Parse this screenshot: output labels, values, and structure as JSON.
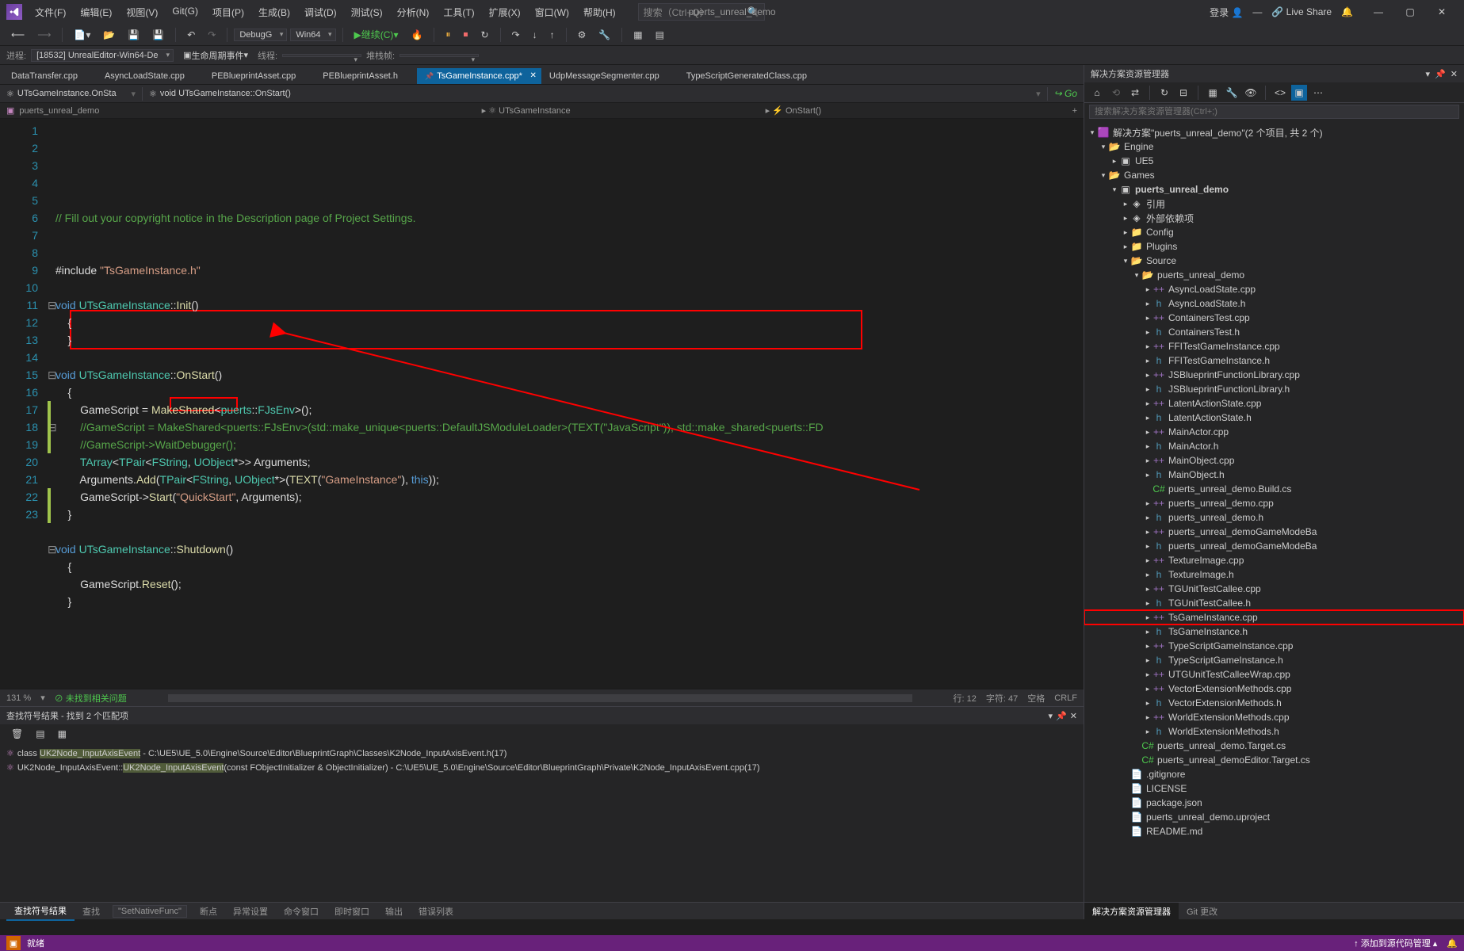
{
  "title_center": "puerts_unreal_demo",
  "login": "登录",
  "live_share": "Live Share",
  "menu": [
    "文件(F)",
    "编辑(E)",
    "视图(V)",
    "Git(G)",
    "项目(P)",
    "生成(B)",
    "调试(D)",
    "测试(S)",
    "分析(N)",
    "工具(T)",
    "扩展(X)",
    "窗口(W)",
    "帮助(H)"
  ],
  "search_placeholder": "搜索（Ctrl+Q）",
  "toolbar": {
    "config": "DebugG",
    "platform": "Win64",
    "run_label": "继续(C)"
  },
  "toolbar2": {
    "process_label": "进程:",
    "process": "[18532] UnrealEditor-Win64-De",
    "lifecycle": "生命周期事件",
    "thread_label": "线程:",
    "stack_label": "堆栈帧:"
  },
  "tabs": [
    {
      "label": "DataTransfer.cpp",
      "pinned": false
    },
    {
      "label": "AsyncLoadState.cpp",
      "pinned": false
    },
    {
      "label": "PEBlueprintAsset.cpp",
      "pinned": false
    },
    {
      "label": "PEBlueprintAsset.h",
      "pinned": false
    },
    {
      "label": "TsGameInstance.cpp*",
      "pinned": true,
      "active": true
    },
    {
      "label": "UdpMessageSegmenter.cpp",
      "pinned": false
    },
    {
      "label": "TypeScriptGeneratedClass.cpp",
      "pinned": false
    }
  ],
  "nav": {
    "scope": "UTsGameInstance.OnSta",
    "func": "void UTsGameInstance::OnStart()",
    "go": "Go"
  },
  "breadcrumb": {
    "project": "puerts_unreal_demo",
    "class": "UTsGameInstance",
    "method": "OnStart()"
  },
  "code": {
    "lines": [
      {
        "n": 1,
        "t": "// Fill out your copyright notice in the Description page of Project Settings.",
        "cls": "c-comment"
      },
      {
        "n": 2,
        "t": ""
      },
      {
        "n": 3,
        "t": ""
      },
      {
        "n": 4,
        "html": "<span class='c-punct'>#include </span><span class='c-string'>\"TsGameInstance.h\"</span>"
      },
      {
        "n": 5,
        "t": ""
      },
      {
        "n": 6,
        "fold": "⊟",
        "html": "<span class='c-keyword'>void</span> <span class='c-type'>UTsGameInstance</span>::<span class='c-func'>Init</span>()"
      },
      {
        "n": 7,
        "t": "{",
        "indent": 1
      },
      {
        "n": 8,
        "t": "}",
        "indent": 1
      },
      {
        "n": 9,
        "t": ""
      },
      {
        "n": 10,
        "fold": "⊟",
        "html": "<span class='c-keyword'>void</span> <span class='c-type'>UTsGameInstance</span>::<span class='c-func'>OnStart</span>()"
      },
      {
        "n": 11,
        "t": "{",
        "indent": 1
      },
      {
        "n": 12,
        "indent": 2,
        "changed": true,
        "html": "GameScript = <span class='c-func'>MakeShared</span>&lt;<span class='c-type'>puerts</span>::<span class='c-type'>FJsEnv</span>&gt;();"
      },
      {
        "n": 13,
        "fold": "⊟",
        "indent": 2,
        "changed": true,
        "html": "<span class='c-comment'>//GameScript = MakeShared&lt;puerts::FJsEnv&gt;(std::make_unique&lt;puerts::DefaultJSModuleLoader&gt;(TEXT(\"JavaScript\")), std::make_shared&lt;puerts::FD</span>"
      },
      {
        "n": 14,
        "indent": 2,
        "changed": true,
        "html": "<span class='c-comment'>//GameScript-&gt;WaitDebugger();</span>"
      },
      {
        "n": 15,
        "indent": 2,
        "html": "<span class='c-type'>TArray</span>&lt;<span class='c-type'>TPair</span>&lt;<span class='c-type'>FString</span>, <span class='c-type'>UObject</span>*&gt;&gt; Arguments;"
      },
      {
        "n": 16,
        "indent": 2,
        "html": "Arguments.<span class='c-func'>Add</span>(<span class='c-type'>TPair</span>&lt;<span class='c-type'>FString</span>, <span class='c-type'>UObject</span>*&gt;(<span class='c-func'>TEXT</span>(<span class='c-string'>\"GameInstance\"</span>), <span class='c-keyword'>this</span>));"
      },
      {
        "n": 17,
        "indent": 2,
        "changed": true,
        "html": "GameScript-&gt;<span class='c-func'>Start</span>(<span class='c-string'>\"QuickStart\"</span>, Arguments);"
      },
      {
        "n": 18,
        "t": "}",
        "indent": 1,
        "changed": true
      },
      {
        "n": 19,
        "t": ""
      },
      {
        "n": 20,
        "fold": "⊟",
        "html": "<span class='c-keyword'>void</span> <span class='c-type'>UTsGameInstance</span>::<span class='c-func'>Shutdown</span>()"
      },
      {
        "n": 21,
        "t": "{",
        "indent": 1
      },
      {
        "n": 22,
        "indent": 2,
        "html": "GameScript.<span class='c-func'>Reset</span>();"
      },
      {
        "n": 23,
        "t": "}",
        "indent": 1
      }
    ]
  },
  "status_strip": {
    "zoom": "131 %",
    "issues": "未找到相关问题",
    "ln_col": "行: 12",
    "char": "字符: 47",
    "ins": "空格",
    "crlf": "CRLF"
  },
  "find": {
    "title": "查找符号结果 - 找到 2 个匹配项",
    "results": [
      {
        "icon": "⚛",
        "prefix": "class ",
        "hl": "UK2Node_InputAxisEvent",
        "suffix": " - C:\\UE5\\UE_5.0\\Engine\\Source\\Editor\\BlueprintGraph\\Classes\\K2Node_InputAxisEvent.h(17)"
      },
      {
        "icon": "⚛",
        "prefix": "UK2Node_InputAxisEvent::",
        "hl": "UK2Node_InputAxisEvent",
        "suffix": "(const FObjectInitializer & ObjectInitializer) - C:\\UE5\\UE_5.0\\Engine\\Source\\Editor\\BlueprintGraph\\Private\\K2Node_InputAxisEvent.cpp(17)"
      }
    ],
    "bottom_tabs": [
      "查找符号结果",
      "查找\"SetNativeFunc\"",
      "断点",
      "异常设置",
      "命令窗口",
      "即时窗口",
      "输出",
      "错误列表"
    ]
  },
  "statusbar": {
    "ready": "就绪",
    "right": "↑ 添加到源代码管理 ▴"
  },
  "solution": {
    "title": "解决方案资源管理器",
    "search_placeholder": "搜索解决方案资源管理器(Ctrl+;)",
    "root": "解决方案\"puerts_unreal_demo\"(2 个项目, 共 2 个)",
    "tree": [
      {
        "d": 0,
        "arrow": "▾",
        "ico": "sln",
        "label": "解决方案\"puerts_unreal_demo\"(2 个项目, 共 2 个)"
      },
      {
        "d": 1,
        "arrow": "▾",
        "ico": "folder-open",
        "label": "Engine"
      },
      {
        "d": 2,
        "arrow": "▸",
        "ico": "proj",
        "label": "UE5"
      },
      {
        "d": 1,
        "arrow": "▾",
        "ico": "folder-open",
        "label": "Games"
      },
      {
        "d": 2,
        "arrow": "▾",
        "ico": "proj",
        "label": "puerts_unreal_demo",
        "bold": true
      },
      {
        "d": 3,
        "arrow": "▸",
        "ico": "ref",
        "label": "引用"
      },
      {
        "d": 3,
        "arrow": "▸",
        "ico": "ref",
        "label": "外部依赖项"
      },
      {
        "d": 3,
        "arrow": "▸",
        "ico": "folder",
        "label": "Config"
      },
      {
        "d": 3,
        "arrow": "▸",
        "ico": "folder",
        "label": "Plugins"
      },
      {
        "d": 3,
        "arrow": "▾",
        "ico": "folder-open",
        "label": "Source"
      },
      {
        "d": 4,
        "arrow": "▾",
        "ico": "folder-open",
        "label": "puerts_unreal_demo"
      },
      {
        "d": 5,
        "arrow": "▸",
        "ico": "cpp",
        "label": "AsyncLoadState.cpp"
      },
      {
        "d": 5,
        "arrow": "▸",
        "ico": "h",
        "label": "AsyncLoadState.h"
      },
      {
        "d": 5,
        "arrow": "▸",
        "ico": "cpp",
        "label": "ContainersTest.cpp"
      },
      {
        "d": 5,
        "arrow": "▸",
        "ico": "h",
        "label": "ContainersTest.h"
      },
      {
        "d": 5,
        "arrow": "▸",
        "ico": "cpp",
        "label": "FFITestGameInstance.cpp"
      },
      {
        "d": 5,
        "arrow": "▸",
        "ico": "h",
        "label": "FFITestGameInstance.h"
      },
      {
        "d": 5,
        "arrow": "▸",
        "ico": "cpp",
        "label": "JSBlueprintFunctionLibrary.cpp"
      },
      {
        "d": 5,
        "arrow": "▸",
        "ico": "h",
        "label": "JSBlueprintFunctionLibrary.h"
      },
      {
        "d": 5,
        "arrow": "▸",
        "ico": "cpp",
        "label": "LatentActionState.cpp"
      },
      {
        "d": 5,
        "arrow": "▸",
        "ico": "h",
        "label": "LatentActionState.h"
      },
      {
        "d": 5,
        "arrow": "▸",
        "ico": "cpp",
        "label": "MainActor.cpp"
      },
      {
        "d": 5,
        "arrow": "▸",
        "ico": "h",
        "label": "MainActor.h"
      },
      {
        "d": 5,
        "arrow": "▸",
        "ico": "cpp",
        "label": "MainObject.cpp"
      },
      {
        "d": 5,
        "arrow": "▸",
        "ico": "h",
        "label": "MainObject.h"
      },
      {
        "d": 5,
        "arrow": "",
        "ico": "cs",
        "label": "puerts_unreal_demo.Build.cs"
      },
      {
        "d": 5,
        "arrow": "▸",
        "ico": "cpp",
        "label": "puerts_unreal_demo.cpp"
      },
      {
        "d": 5,
        "arrow": "▸",
        "ico": "h",
        "label": "puerts_unreal_demo.h"
      },
      {
        "d": 5,
        "arrow": "▸",
        "ico": "cpp",
        "label": "puerts_unreal_demoGameModeBa"
      },
      {
        "d": 5,
        "arrow": "▸",
        "ico": "h",
        "label": "puerts_unreal_demoGameModeBa"
      },
      {
        "d": 5,
        "arrow": "▸",
        "ico": "cpp",
        "label": "TextureImage.cpp"
      },
      {
        "d": 5,
        "arrow": "▸",
        "ico": "h",
        "label": "TextureImage.h"
      },
      {
        "d": 5,
        "arrow": "▸",
        "ico": "cpp",
        "label": "TGUnitTestCallee.cpp"
      },
      {
        "d": 5,
        "arrow": "▸",
        "ico": "h",
        "label": "TGUnitTestCallee.h"
      },
      {
        "d": 5,
        "arrow": "▸",
        "ico": "cpp",
        "label": "TsGameInstance.cpp",
        "highlighted": true
      },
      {
        "d": 5,
        "arrow": "▸",
        "ico": "h",
        "label": "TsGameInstance.h"
      },
      {
        "d": 5,
        "arrow": "▸",
        "ico": "cpp",
        "label": "TypeScriptGameInstance.cpp"
      },
      {
        "d": 5,
        "arrow": "▸",
        "ico": "h",
        "label": "TypeScriptGameInstance.h"
      },
      {
        "d": 5,
        "arrow": "▸",
        "ico": "cpp",
        "label": "UTGUnitTestCalleeWrap.cpp"
      },
      {
        "d": 5,
        "arrow": "▸",
        "ico": "cpp",
        "label": "VectorExtensionMethods.cpp"
      },
      {
        "d": 5,
        "arrow": "▸",
        "ico": "h",
        "label": "VectorExtensionMethods.h"
      },
      {
        "d": 5,
        "arrow": "▸",
        "ico": "cpp",
        "label": "WorldExtensionMethods.cpp"
      },
      {
        "d": 5,
        "arrow": "▸",
        "ico": "h",
        "label": "WorldExtensionMethods.h"
      },
      {
        "d": 4,
        "arrow": "",
        "ico": "cs",
        "label": "puerts_unreal_demo.Target.cs"
      },
      {
        "d": 4,
        "arrow": "",
        "ico": "cs",
        "label": "puerts_unreal_demoEditor.Target.cs"
      },
      {
        "d": 3,
        "arrow": "",
        "ico": "file",
        "label": ".gitignore"
      },
      {
        "d": 3,
        "arrow": "",
        "ico": "file",
        "label": "LICENSE"
      },
      {
        "d": 3,
        "arrow": "",
        "ico": "file",
        "label": "package.json"
      },
      {
        "d": 3,
        "arrow": "",
        "ico": "file",
        "label": "puerts_unreal_demo.uproject"
      },
      {
        "d": 3,
        "arrow": "",
        "ico": "file",
        "label": "README.md"
      }
    ],
    "bottom_tabs": [
      "解决方案资源管理器",
      "Git 更改"
    ]
  }
}
